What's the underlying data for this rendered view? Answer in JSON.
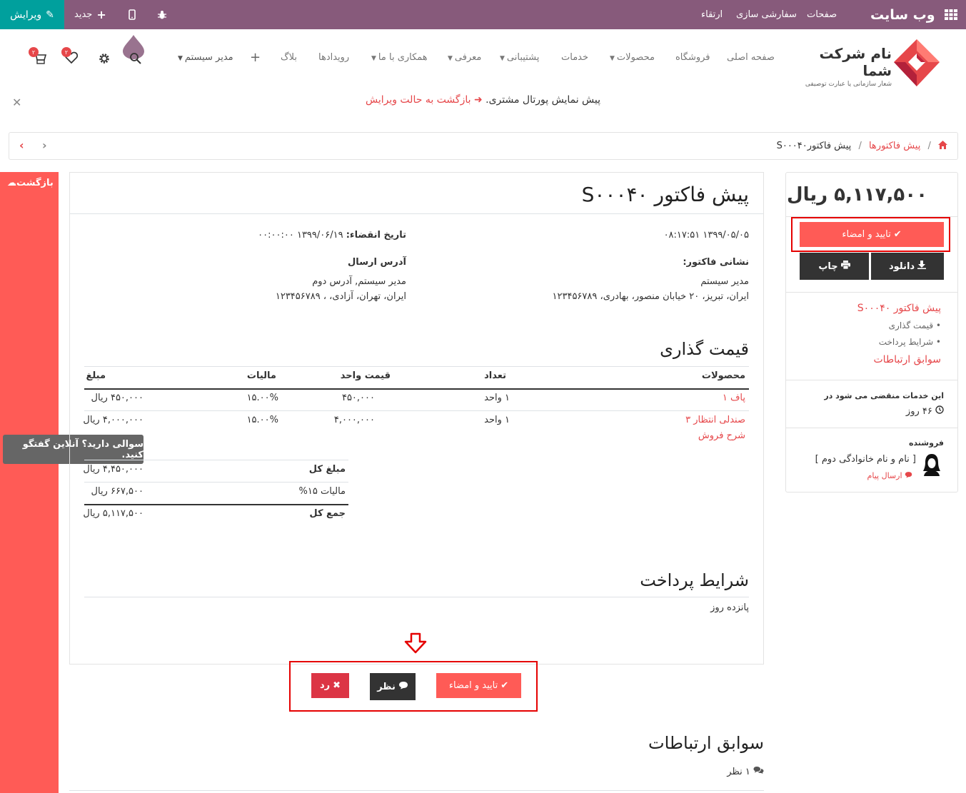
{
  "adminbar": {
    "brand": "وب سایت",
    "menu": [
      "صفحات",
      "سفارشی سازی",
      "ارتقاء"
    ],
    "edit_label": "ویرایش",
    "new_label": "جدید"
  },
  "nav": {
    "logo_name": "نام شرکت شما",
    "logo_sub": "شعار سازمانی یا عبارت توصیفی",
    "links": [
      "صفحه اصلی",
      "فروشگاه",
      "محصولات",
      "خدمات",
      "پشتیبانی",
      "معرفی",
      "همکاری با ما",
      "رویدادها",
      "بلاگ"
    ],
    "user": "مدیر سیستم",
    "cart_count": "۲",
    "wishlist_count": "۲"
  },
  "notice": {
    "text": "پیش نمایش پورتال مشتری.",
    "back_link": "بازگشت به حالت ویرایش"
  },
  "breadcrumb": {
    "parent": "پیش فاکتورها",
    "current": "پیش فاکتورS۰۰۰۴۰"
  },
  "strip": {
    "back": "بازگشت",
    "chat": "سوالی دارید؟ آنلاین گفتگو کنید."
  },
  "quote": {
    "title": "پیش فاکتور S۰۰۰۴۰",
    "date": "۱۳۹۹/۰۵/۰۵ ۰۸:۱۷:۵۱",
    "expiry_label": "تاریخ انقضاء:",
    "expiry_value": "۱۳۹۹/۰۶/۱۹ ۰۰:۰۰:۰۰",
    "invoice_address_label": "نشانی فاکتور:",
    "invoice_name": "مدیر سیستم",
    "invoice_address": "ایران، تبریز، ۲۰ خیابان منصور، بهادری، ۱۲۳۴۵۶۷۸۹",
    "shipping_label": "آدرس ارسال",
    "shipping_name": "مدیر سیستم, آدرس دوم",
    "shipping_address": "ایران، تهران، آزادی، ، ۱۲۳۴۵۶۷۸۹"
  },
  "pricing": {
    "heading": "قیمت گذاری",
    "columns": [
      "محصولات",
      "تعداد",
      "قیمت واحد",
      "مالیات",
      "مبلغ"
    ],
    "rows": [
      {
        "product": "پاف ۱",
        "qty": "۱ واحد",
        "unit_price": "۴۵۰,۰۰۰",
        "tax": "۱۵.۰۰%",
        "amount": "۴۵۰,۰۰۰ ریال"
      },
      {
        "product": "صندلی انتظار ۳",
        "product_sub": "شرح فروش",
        "qty": "۱ واحد",
        "unit_price": "۴,۰۰۰,۰۰۰",
        "tax": "۱۵.۰۰%",
        "amount": "۴,۰۰۰,۰۰۰ ریال"
      }
    ],
    "subtotal_label": "مبلغ کل",
    "subtotal_value": "۴,۴۵۰,۰۰۰ ریال",
    "tax_label": "مالیات ۱۵%",
    "tax_value": "۶۶۷,۵۰۰ ریال",
    "total_label": "جمع کل",
    "total_value": "۵,۱۱۷,۵۰۰ ریال"
  },
  "terms": {
    "heading": "شرایط پرداخت",
    "text": "پانزده روز"
  },
  "actions": {
    "accept": "تایید و امضاء",
    "feedback": "نظر",
    "reject": "رد"
  },
  "history": {
    "heading": "سوابق ارتباطات",
    "count": "۱ نظر"
  },
  "sidebar": {
    "amount": "۵,۱۱۷,۵۰۰ ریال",
    "accept": "تایید و امضاء",
    "download": "دانلود",
    "print": "چاپ",
    "nav_title": "پیش فاکتور S۰۰۰۴۰",
    "nav_items": [
      "قیمت گذاری",
      "شرایط پرداخت"
    ],
    "nav_history": "سوابق ارتباطات",
    "expire_label": "این خدمات منقضی می شود در",
    "expire_value": "۴۶ روز",
    "salesperson_label": "فروشنده",
    "salesperson_name": "[ نام و نام خانوادگی دوم ]",
    "send_message": "ارسال پیام"
  },
  "colors": {
    "admin_bar": "#875a7b",
    "edit_button": "#00a09d",
    "accent": "#ff5b56",
    "link": "#e6474a",
    "highlight_box": "#e50000"
  }
}
